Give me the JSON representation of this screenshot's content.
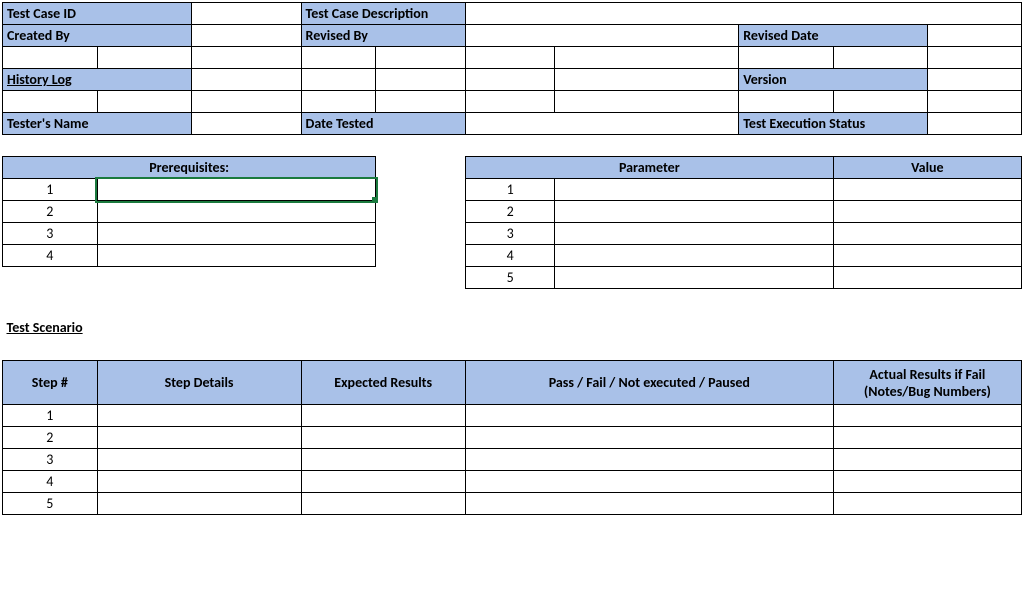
{
  "header": {
    "test_case_id_label": "Test Case ID",
    "test_case_description_label": "Test Case Description",
    "created_by_label": "Created By",
    "revised_by_label": "Revised By",
    "revised_date_label": "Revised Date",
    "history_log_label": "History Log",
    "version_label": "Version",
    "testers_name_label": "Tester's Name",
    "date_tested_label": "Date Tested",
    "test_execution_status_label": "Test Execution Status"
  },
  "prereq": {
    "title": "Prerequisites:",
    "rows": [
      "1",
      "2",
      "3",
      "4"
    ]
  },
  "params": {
    "parameter_label": "Parameter",
    "value_label": "Value",
    "rows": [
      "1",
      "2",
      "3",
      "4",
      "5"
    ]
  },
  "scenario": {
    "title": "Test Scenario",
    "step_num_label": "Step #",
    "step_details_label": "Step Details",
    "expected_results_label": "Expected Results",
    "pass_fail_label": "Pass / Fail / Not executed / Paused",
    "actual_results_label": "Actual Results if Fail (Notes/Bug Numbers)",
    "rows": [
      "1",
      "2",
      "3",
      "4",
      "5"
    ]
  }
}
